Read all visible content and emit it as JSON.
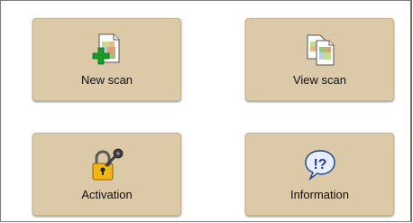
{
  "menu": {
    "tiles": [
      {
        "label": "New scan",
        "icon": "new-scan-icon"
      },
      {
        "label": "View scan",
        "icon": "view-scan-icon"
      },
      {
        "label": "Activation",
        "icon": "padlock-key-icon"
      },
      {
        "label": "Information",
        "icon": "speech-bubble-question-icon"
      }
    ]
  },
  "colors": {
    "tile_background": "#dcc9a8",
    "tile_border": "#c9b48e",
    "plus_green": "#1a9a2a",
    "lock_gold": "#f2b612",
    "info_text": "#1c3f8e",
    "bubble_fill": "#e7eef8"
  }
}
